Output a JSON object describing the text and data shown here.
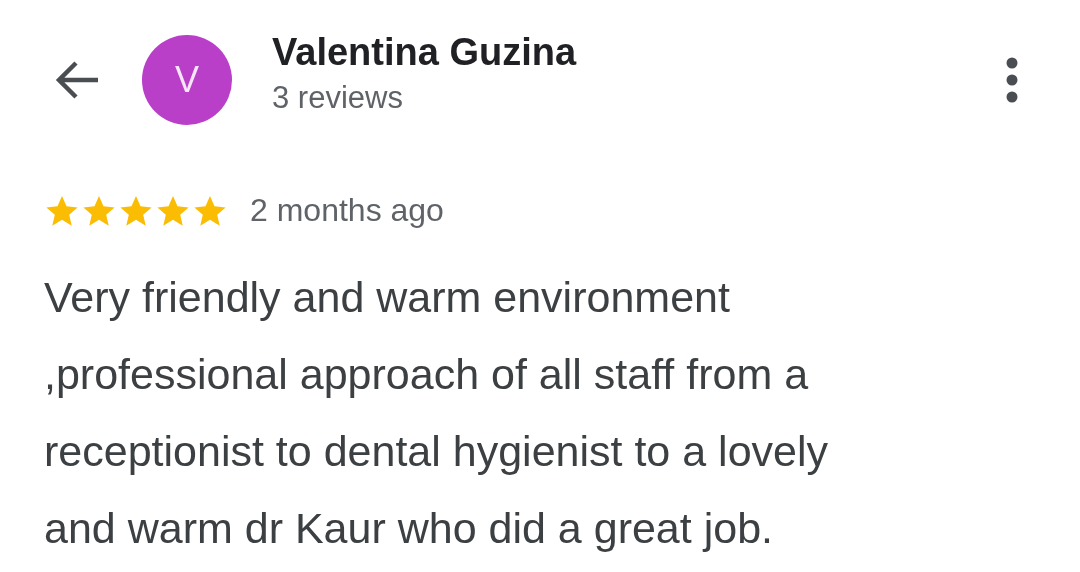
{
  "header": {
    "author": "Valentina Guzina",
    "avatar": {
      "initial": "V",
      "color": "#b93fc9"
    },
    "subtitle": "3 reviews"
  },
  "review": {
    "stars": 5,
    "time": "2 months ago",
    "text_lines": [
      "Very friendly and warm environment",
      ",professional approach of all staff from a",
      "receptionist to dental hygienist to a lovely",
      "and warm dr Kaur who did a great job."
    ]
  }
}
